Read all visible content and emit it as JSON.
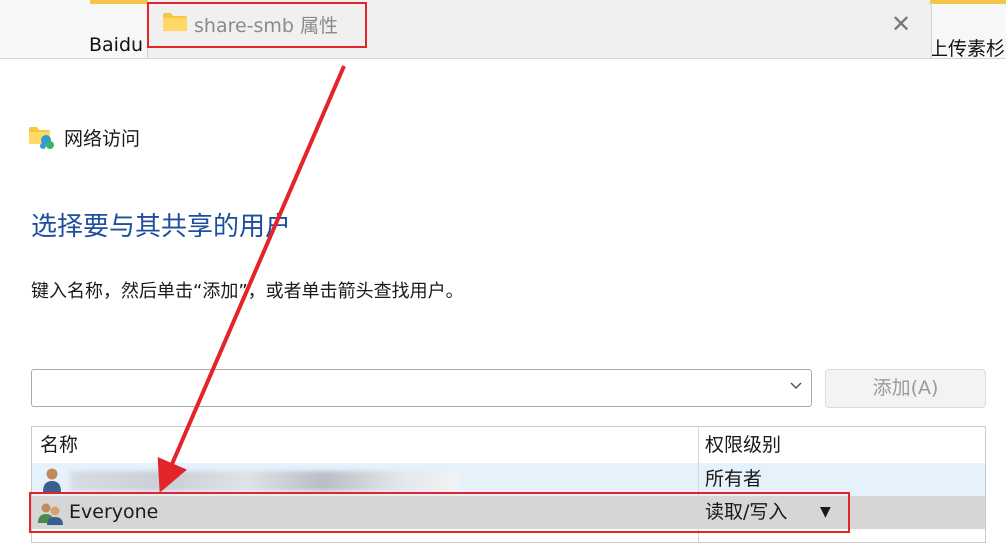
{
  "background_window": {
    "left_text": "Baidu",
    "right_text": "上传素杉"
  },
  "dialog": {
    "title": "share-smb 属性",
    "close_glyph": "✕"
  },
  "nav": {
    "label": "网络访问"
  },
  "heading": "选择要与其共享的用户",
  "instruction": "键入名称，然后单击“添加”，或者单击箭头查找用户。",
  "user_input": {
    "value": "",
    "dropdown_glyph": "⌵"
  },
  "add_button": {
    "label": "添加(A)"
  },
  "table": {
    "headers": [
      "名称",
      "权限级别"
    ],
    "rows": [
      {
        "name": "",
        "permission": "所有者",
        "selected": false
      },
      {
        "name": "Everyone",
        "permission": "读取/写入",
        "selected": true,
        "dropdown_glyph": "▼"
      }
    ]
  },
  "colors": {
    "heading_blue": "#1f4e9c",
    "annotation_red": "#e3242b",
    "row_hover": "#e5f1fb",
    "row_selected": "#d6d6d6"
  }
}
